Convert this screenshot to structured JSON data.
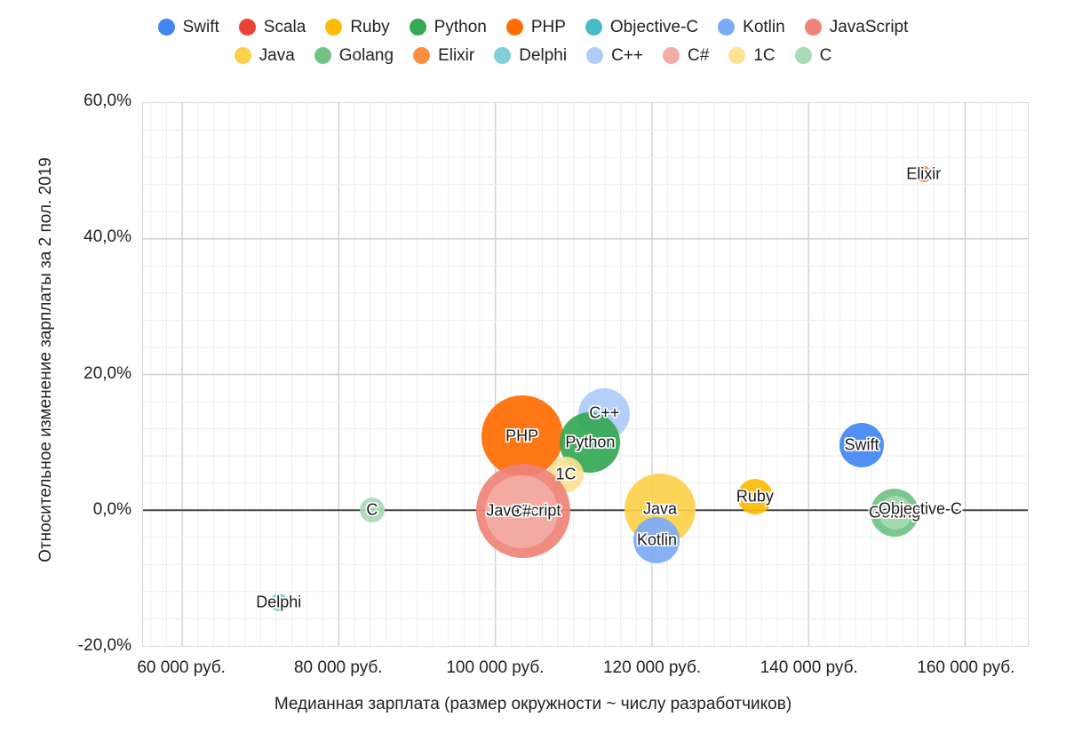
{
  "legend": {
    "rows": [
      [
        {
          "label": "Swift",
          "color": "#4285F4"
        },
        {
          "label": "Scala",
          "color": "#EA4335"
        },
        {
          "label": "Ruby",
          "color": "#FBBC04"
        },
        {
          "label": "Python",
          "color": "#34A853"
        },
        {
          "label": "PHP",
          "color": "#FF6D01"
        },
        {
          "label": "Objective-C",
          "color": "#46BDC6"
        },
        {
          "label": "Kotlin",
          "color": "#7BAAF7"
        },
        {
          "label": "JavaScript",
          "color": "#EE8377"
        }
      ],
      [
        {
          "label": "Java",
          "color": "#FCD04A"
        },
        {
          "label": "Golang",
          "color": "#71C287"
        },
        {
          "label": "Elixir",
          "color": "#FA903E"
        },
        {
          "label": "Delphi",
          "color": "#7FCFD4"
        },
        {
          "label": "C++",
          "color": "#AECBFA"
        },
        {
          "label": "C#",
          "color": "#F2ADA6"
        },
        {
          "label": "1C",
          "color": "#FDE293"
        },
        {
          "label": "C",
          "color": "#A8DAB5"
        }
      ]
    ]
  },
  "axes": {
    "y_title": "Относительное изменение зарплаты за 2 пол. 2019",
    "x_title": "Медианная зарплата (размер окружности ~ числу разработчиков)",
    "y_ticks": [
      "60,0%",
      "40,0%",
      "20,0%",
      "0,0%",
      "-20,0%"
    ],
    "x_ticks": [
      "60 000 руб.",
      "80 000 руб.",
      "100 000 руб.",
      "120 000 руб.",
      "140 000 руб.",
      "160 000 руб."
    ]
  },
  "chart_data": {
    "type": "scatter",
    "title": "",
    "xlabel": "Медианная зарплата (размер окружности ~ числу разработчиков)",
    "ylabel": "Относительное изменение зарплаты за 2 пол. 2019",
    "xlim": [
      55000,
      168000
    ],
    "ylim": [
      -20,
      60
    ],
    "xtick_values": [
      60000,
      80000,
      100000,
      120000,
      140000,
      160000
    ],
    "ytick_values": [
      60,
      40,
      20,
      0,
      -20
    ],
    "grid": true,
    "legend_position": "top",
    "bubble_meaning": "размер окружности ~ числу разработчиков",
    "points": [
      {
        "name": "Elixir",
        "x": 154500,
        "y": 49.5,
        "size": 9,
        "color": "#FA903E",
        "label_dx": 0,
        "label_dy": 0
      },
      {
        "name": "C++",
        "x": 113800,
        "y": 14.3,
        "size": 29,
        "color": "#AECBFA",
        "label_dx": 0,
        "label_dy": -1
      },
      {
        "name": "PHP",
        "x": 103300,
        "y": 11.0,
        "size": 46,
        "color": "#FF6D01",
        "label_dx": 0,
        "label_dy": 0
      },
      {
        "name": "Swift",
        "x": 146600,
        "y": 9.8,
        "size": 25,
        "color": "#4285F4",
        "label_dx": 0,
        "label_dy": 0
      },
      {
        "name": "Python",
        "x": 112000,
        "y": 10.2,
        "size": 34,
        "color": "#34A853",
        "label_dx": 0,
        "label_dy": 0
      },
      {
        "name": "1C",
        "x": 108900,
        "y": 5.5,
        "size": 20,
        "color": "#FDE293",
        "label_dx": 0,
        "label_dy": 0
      },
      {
        "name": "Ruby",
        "x": 133000,
        "y": 2.2,
        "size": 20,
        "color": "#FBBC04",
        "label_dx": 0,
        "label_dy": 0
      },
      {
        "name": "Java",
        "x": 120900,
        "y": 0.4,
        "size": 40,
        "color": "#FCD04A",
        "label_dx": 0,
        "label_dy": 0
      },
      {
        "name": "JavaScript",
        "x": 103500,
        "y": 0.1,
        "size": 53,
        "color": "#EE8377",
        "label_dx": 0,
        "label_dy": 0
      },
      {
        "name": "C#",
        "x": 103200,
        "y": 0.0,
        "size": 41,
        "color": "#F2ADA6",
        "label_dx": 0,
        "label_dy": 0
      },
      {
        "name": "C",
        "x": 84200,
        "y": 0.2,
        "size": 14,
        "color": "#A8DAB5",
        "label_dx": 0,
        "label_dy": 0
      },
      {
        "name": "Golang",
        "x": 150800,
        "y": -0.1,
        "size": 27,
        "color": "#71C287",
        "label_dx": 0,
        "label_dy": 0
      },
      {
        "name": "Objective-C",
        "x": 150900,
        "y": -0.1,
        "size": 19,
        "color": "#A8DAB5",
        "label_dx": 28,
        "label_dy": -4
      },
      {
        "name": "Kotlin",
        "x": 120500,
        "y": -4.2,
        "size": 26,
        "color": "#7BAAF7",
        "label_dx": 0,
        "label_dy": 0
      },
      {
        "name": "Delphi",
        "x": 72300,
        "y": -13.4,
        "size": 10,
        "color": "#7FCFD4",
        "label_dx": 0,
        "label_dy": 0
      }
    ]
  }
}
